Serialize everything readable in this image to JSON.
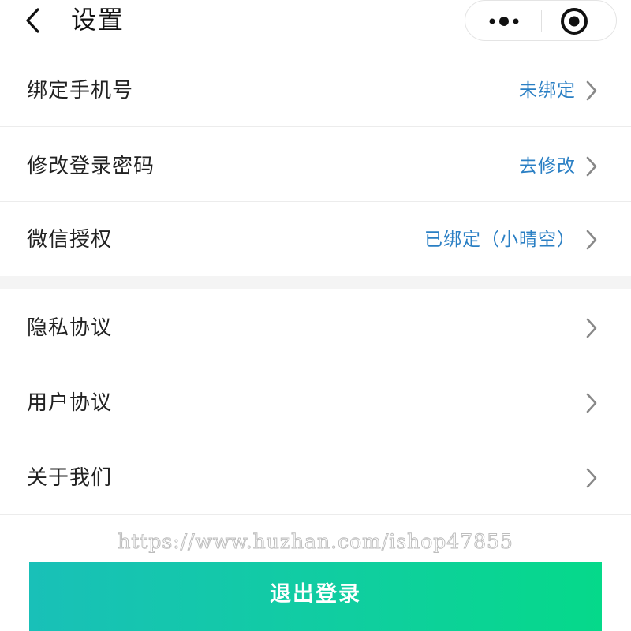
{
  "navbar": {
    "title": "设置",
    "back_icon": "chevron-left-icon",
    "more_icon": "more-dots-icon",
    "close_icon": "target-close-icon"
  },
  "settings_group_1": [
    {
      "label": "绑定手机号",
      "value": "未绑定"
    },
    {
      "label": "修改登录密码",
      "value": "去修改"
    },
    {
      "label": "微信授权",
      "value": "已绑定（小晴空）"
    }
  ],
  "settings_group_2": [
    {
      "label": "隐私协议"
    },
    {
      "label": "用户协议"
    },
    {
      "label": "关于我们"
    }
  ],
  "watermark": "https://www.huzhan.com/ishop47855",
  "logout": {
    "label": "退出登录"
  },
  "colors": {
    "value_text": "#2a7fc4",
    "chevron": "#888888",
    "button_gradient_start": "#19c0b8",
    "button_gradient_end": "#05d98a"
  }
}
